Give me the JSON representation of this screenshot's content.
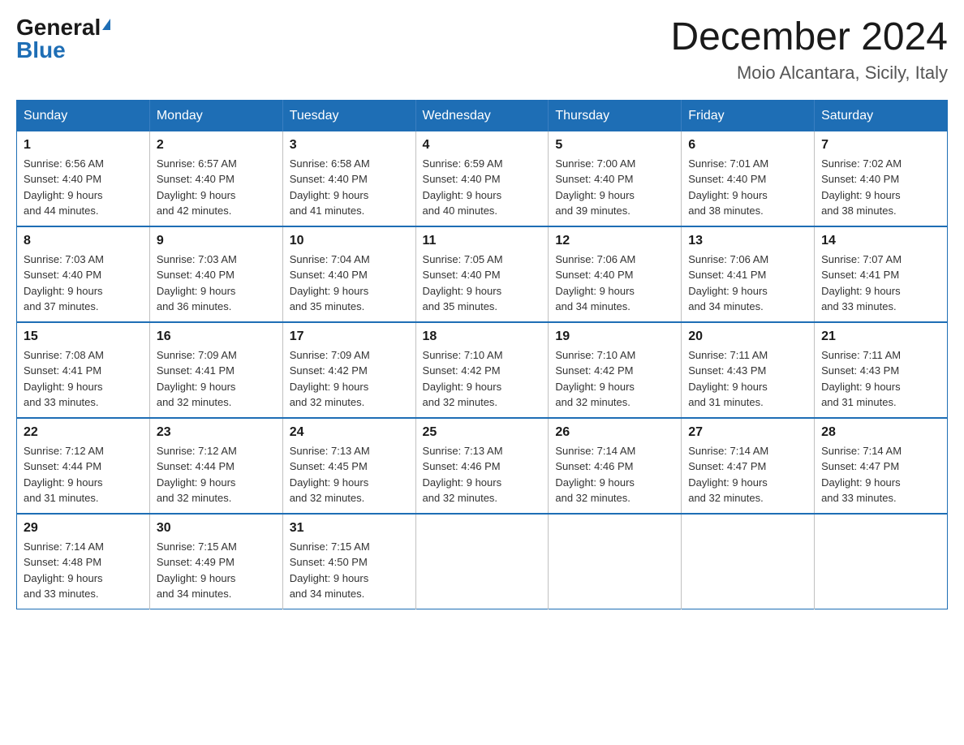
{
  "header": {
    "logo": {
      "general": "General",
      "blue": "Blue"
    },
    "title": "December 2024",
    "location": "Moio Alcantara, Sicily, Italy"
  },
  "calendar": {
    "days_of_week": [
      "Sunday",
      "Monday",
      "Tuesday",
      "Wednesday",
      "Thursday",
      "Friday",
      "Saturday"
    ],
    "weeks": [
      [
        {
          "day": "1",
          "sunrise": "6:56 AM",
          "sunset": "4:40 PM",
          "daylight": "9 hours and 44 minutes."
        },
        {
          "day": "2",
          "sunrise": "6:57 AM",
          "sunset": "4:40 PM",
          "daylight": "9 hours and 42 minutes."
        },
        {
          "day": "3",
          "sunrise": "6:58 AM",
          "sunset": "4:40 PM",
          "daylight": "9 hours and 41 minutes."
        },
        {
          "day": "4",
          "sunrise": "6:59 AM",
          "sunset": "4:40 PM",
          "daylight": "9 hours and 40 minutes."
        },
        {
          "day": "5",
          "sunrise": "7:00 AM",
          "sunset": "4:40 PM",
          "daylight": "9 hours and 39 minutes."
        },
        {
          "day": "6",
          "sunrise": "7:01 AM",
          "sunset": "4:40 PM",
          "daylight": "9 hours and 38 minutes."
        },
        {
          "day": "7",
          "sunrise": "7:02 AM",
          "sunset": "4:40 PM",
          "daylight": "9 hours and 38 minutes."
        }
      ],
      [
        {
          "day": "8",
          "sunrise": "7:03 AM",
          "sunset": "4:40 PM",
          "daylight": "9 hours and 37 minutes."
        },
        {
          "day": "9",
          "sunrise": "7:03 AM",
          "sunset": "4:40 PM",
          "daylight": "9 hours and 36 minutes."
        },
        {
          "day": "10",
          "sunrise": "7:04 AM",
          "sunset": "4:40 PM",
          "daylight": "9 hours and 35 minutes."
        },
        {
          "day": "11",
          "sunrise": "7:05 AM",
          "sunset": "4:40 PM",
          "daylight": "9 hours and 35 minutes."
        },
        {
          "day": "12",
          "sunrise": "7:06 AM",
          "sunset": "4:40 PM",
          "daylight": "9 hours and 34 minutes."
        },
        {
          "day": "13",
          "sunrise": "7:06 AM",
          "sunset": "4:41 PM",
          "daylight": "9 hours and 34 minutes."
        },
        {
          "day": "14",
          "sunrise": "7:07 AM",
          "sunset": "4:41 PM",
          "daylight": "9 hours and 33 minutes."
        }
      ],
      [
        {
          "day": "15",
          "sunrise": "7:08 AM",
          "sunset": "4:41 PM",
          "daylight": "9 hours and 33 minutes."
        },
        {
          "day": "16",
          "sunrise": "7:09 AM",
          "sunset": "4:41 PM",
          "daylight": "9 hours and 32 minutes."
        },
        {
          "day": "17",
          "sunrise": "7:09 AM",
          "sunset": "4:42 PM",
          "daylight": "9 hours and 32 minutes."
        },
        {
          "day": "18",
          "sunrise": "7:10 AM",
          "sunset": "4:42 PM",
          "daylight": "9 hours and 32 minutes."
        },
        {
          "day": "19",
          "sunrise": "7:10 AM",
          "sunset": "4:42 PM",
          "daylight": "9 hours and 32 minutes."
        },
        {
          "day": "20",
          "sunrise": "7:11 AM",
          "sunset": "4:43 PM",
          "daylight": "9 hours and 31 minutes."
        },
        {
          "day": "21",
          "sunrise": "7:11 AM",
          "sunset": "4:43 PM",
          "daylight": "9 hours and 31 minutes."
        }
      ],
      [
        {
          "day": "22",
          "sunrise": "7:12 AM",
          "sunset": "4:44 PM",
          "daylight": "9 hours and 31 minutes."
        },
        {
          "day": "23",
          "sunrise": "7:12 AM",
          "sunset": "4:44 PM",
          "daylight": "9 hours and 32 minutes."
        },
        {
          "day": "24",
          "sunrise": "7:13 AM",
          "sunset": "4:45 PM",
          "daylight": "9 hours and 32 minutes."
        },
        {
          "day": "25",
          "sunrise": "7:13 AM",
          "sunset": "4:46 PM",
          "daylight": "9 hours and 32 minutes."
        },
        {
          "day": "26",
          "sunrise": "7:14 AM",
          "sunset": "4:46 PM",
          "daylight": "9 hours and 32 minutes."
        },
        {
          "day": "27",
          "sunrise": "7:14 AM",
          "sunset": "4:47 PM",
          "daylight": "9 hours and 32 minutes."
        },
        {
          "day": "28",
          "sunrise": "7:14 AM",
          "sunset": "4:47 PM",
          "daylight": "9 hours and 33 minutes."
        }
      ],
      [
        {
          "day": "29",
          "sunrise": "7:14 AM",
          "sunset": "4:48 PM",
          "daylight": "9 hours and 33 minutes."
        },
        {
          "day": "30",
          "sunrise": "7:15 AM",
          "sunset": "4:49 PM",
          "daylight": "9 hours and 34 minutes."
        },
        {
          "day": "31",
          "sunrise": "7:15 AM",
          "sunset": "4:50 PM",
          "daylight": "9 hours and 34 minutes."
        },
        null,
        null,
        null,
        null
      ]
    ],
    "labels": {
      "sunrise": "Sunrise: ",
      "sunset": "Sunset: ",
      "daylight": "Daylight: "
    }
  }
}
